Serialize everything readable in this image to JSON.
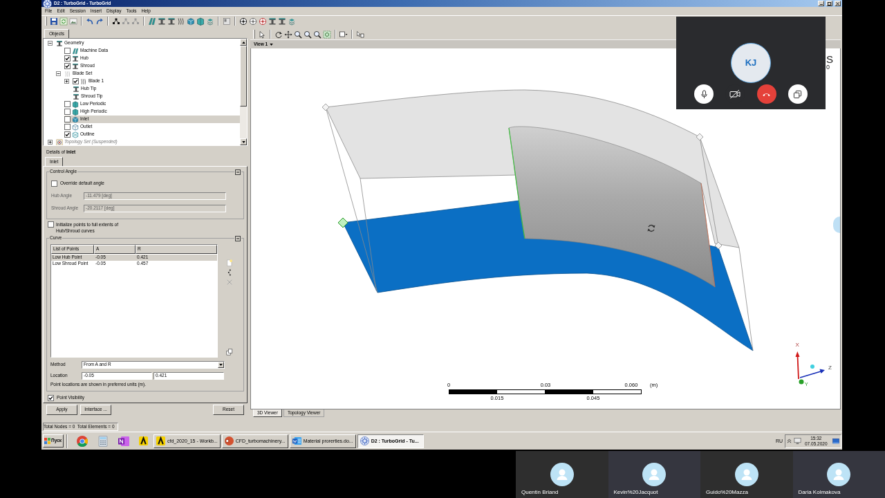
{
  "window": {
    "title": "D2 : TurboGrid - TurboGrid"
  },
  "menu": [
    "File",
    "Edit",
    "Session",
    "Insert",
    "Display",
    "Tools",
    "Help"
  ],
  "objects_panel": {
    "tabs": [
      {
        "label": "Objects",
        "selected": true
      }
    ],
    "tree": [
      {
        "label": "Geometry",
        "kind": "geometry",
        "expanded": true,
        "selected": false,
        "children": [
          {
            "label": "Machine Data",
            "kind": "machine",
            "checked": false,
            "selected": false
          },
          {
            "label": "Hub",
            "kind": "surface",
            "checked": true,
            "selected": false
          },
          {
            "label": "Shroud",
            "kind": "surface",
            "checked": true,
            "selected": false
          },
          {
            "label": "Blade Set",
            "kind": "blade-set",
            "expanded": true,
            "selected": false,
            "children": [
              {
                "label": "Blade 1",
                "kind": "blade",
                "expanded": false,
                "checked": true,
                "selected": false
              },
              {
                "label": "Hub Tip",
                "kind": "surface",
                "selected": false
              },
              {
                "label": "Shroud Tip",
                "kind": "surface",
                "selected": false
              }
            ]
          },
          {
            "label": "Low Periodic",
            "kind": "periodic",
            "checked": false,
            "selected": false
          },
          {
            "label": "High Periodic",
            "kind": "periodic",
            "checked": false,
            "selected": false
          },
          {
            "label": "Inlet",
            "kind": "inlet",
            "checked": false,
            "selected": true
          },
          {
            "label": "Outlet",
            "kind": "outlet",
            "checked": false,
            "selected": false
          },
          {
            "label": "Outline",
            "kind": "outline",
            "checked": true,
            "selected": false
          }
        ]
      },
      {
        "label": "Topology Set (Suspended)",
        "kind": "topology",
        "expanded": false,
        "suspended": true,
        "selected": false
      }
    ]
  },
  "details": {
    "heading": "Details of **Inlet**",
    "tabs": [
      {
        "label": "Inlet",
        "selected": true
      }
    ],
    "control_angle": {
      "title": "Control Angle",
      "expanded": true,
      "override": {
        "label": "Override default angle",
        "checked": false
      },
      "fields": [
        {
          "label": "Hub Angle",
          "value": "-11.479 [deg]",
          "disabled": true
        },
        {
          "label": "Shroud Angle",
          "value": "-20.2117 [deg]",
          "disabled": true
        }
      ]
    },
    "initialize": {
      "label": "Initialize points to full extents of Hub/Shroud curves",
      "checked": false
    },
    "curve": {
      "title": "Curve",
      "expanded": true,
      "columns": [
        "List of Points",
        "A",
        "R"
      ],
      "rows": [
        {
          "cells": [
            "Low Hub Point",
            "-0.05",
            "0.421"
          ],
          "selected": true
        },
        {
          "cells": [
            "Low Shroud Point",
            "-0.05",
            "0.457"
          ],
          "selected": false
        }
      ],
      "method": {
        "label": "Method",
        "value": "From A and R"
      },
      "location": {
        "label": "Location",
        "values": [
          "-0.05",
          "0.421"
        ]
      },
      "note": "Point locations are shown in preferred units (m)."
    },
    "point_visibility": {
      "label": "Point Visibility",
      "checked": true
    },
    "buttons": [
      "Apply",
      "Interface ...",
      "Reset"
    ]
  },
  "viewer": {
    "view_menu": "View 1",
    "logo_fragment": [
      "S",
      "0"
    ],
    "scale": {
      "top_labels": [
        "0",
        "0.03",
        "0.060"
      ],
      "unit": "(m)",
      "bottom_labels": [
        "0.015",
        "0.045"
      ]
    },
    "axes": [
      "X",
      "Y",
      "Z"
    ],
    "tabs": [
      {
        "label": "3D Viewer",
        "selected": true
      },
      {
        "label": "Topology Viewer",
        "selected": false
      }
    ]
  },
  "status_bar": "Total Nodes = 0  Total Elements = 0",
  "taskbar": {
    "start": "Пуск",
    "tasks": [
      {
        "label": "cfd_2020_15 - Workb...",
        "kind": "workbench",
        "selected": false
      },
      {
        "label": "CFD_turbomachinery...",
        "kind": "slides",
        "selected": false
      },
      {
        "label": "Material prorerties.do...",
        "kind": "document",
        "selected": false
      },
      {
        "label": "D2 : TurboGrid - Tu...",
        "kind": "turbogrid",
        "selected": true
      }
    ],
    "language": "RU",
    "clock": {
      "time": "15:32",
      "date": "07.05.2020"
    }
  },
  "call": {
    "initials": "KJ",
    "microphone_on": true,
    "camera_on": false,
    "participants": [
      "Quentin Briand",
      "Kevin%20Jacquot",
      "Guido%20Mazza",
      "Daria Kolmakova"
    ]
  }
}
